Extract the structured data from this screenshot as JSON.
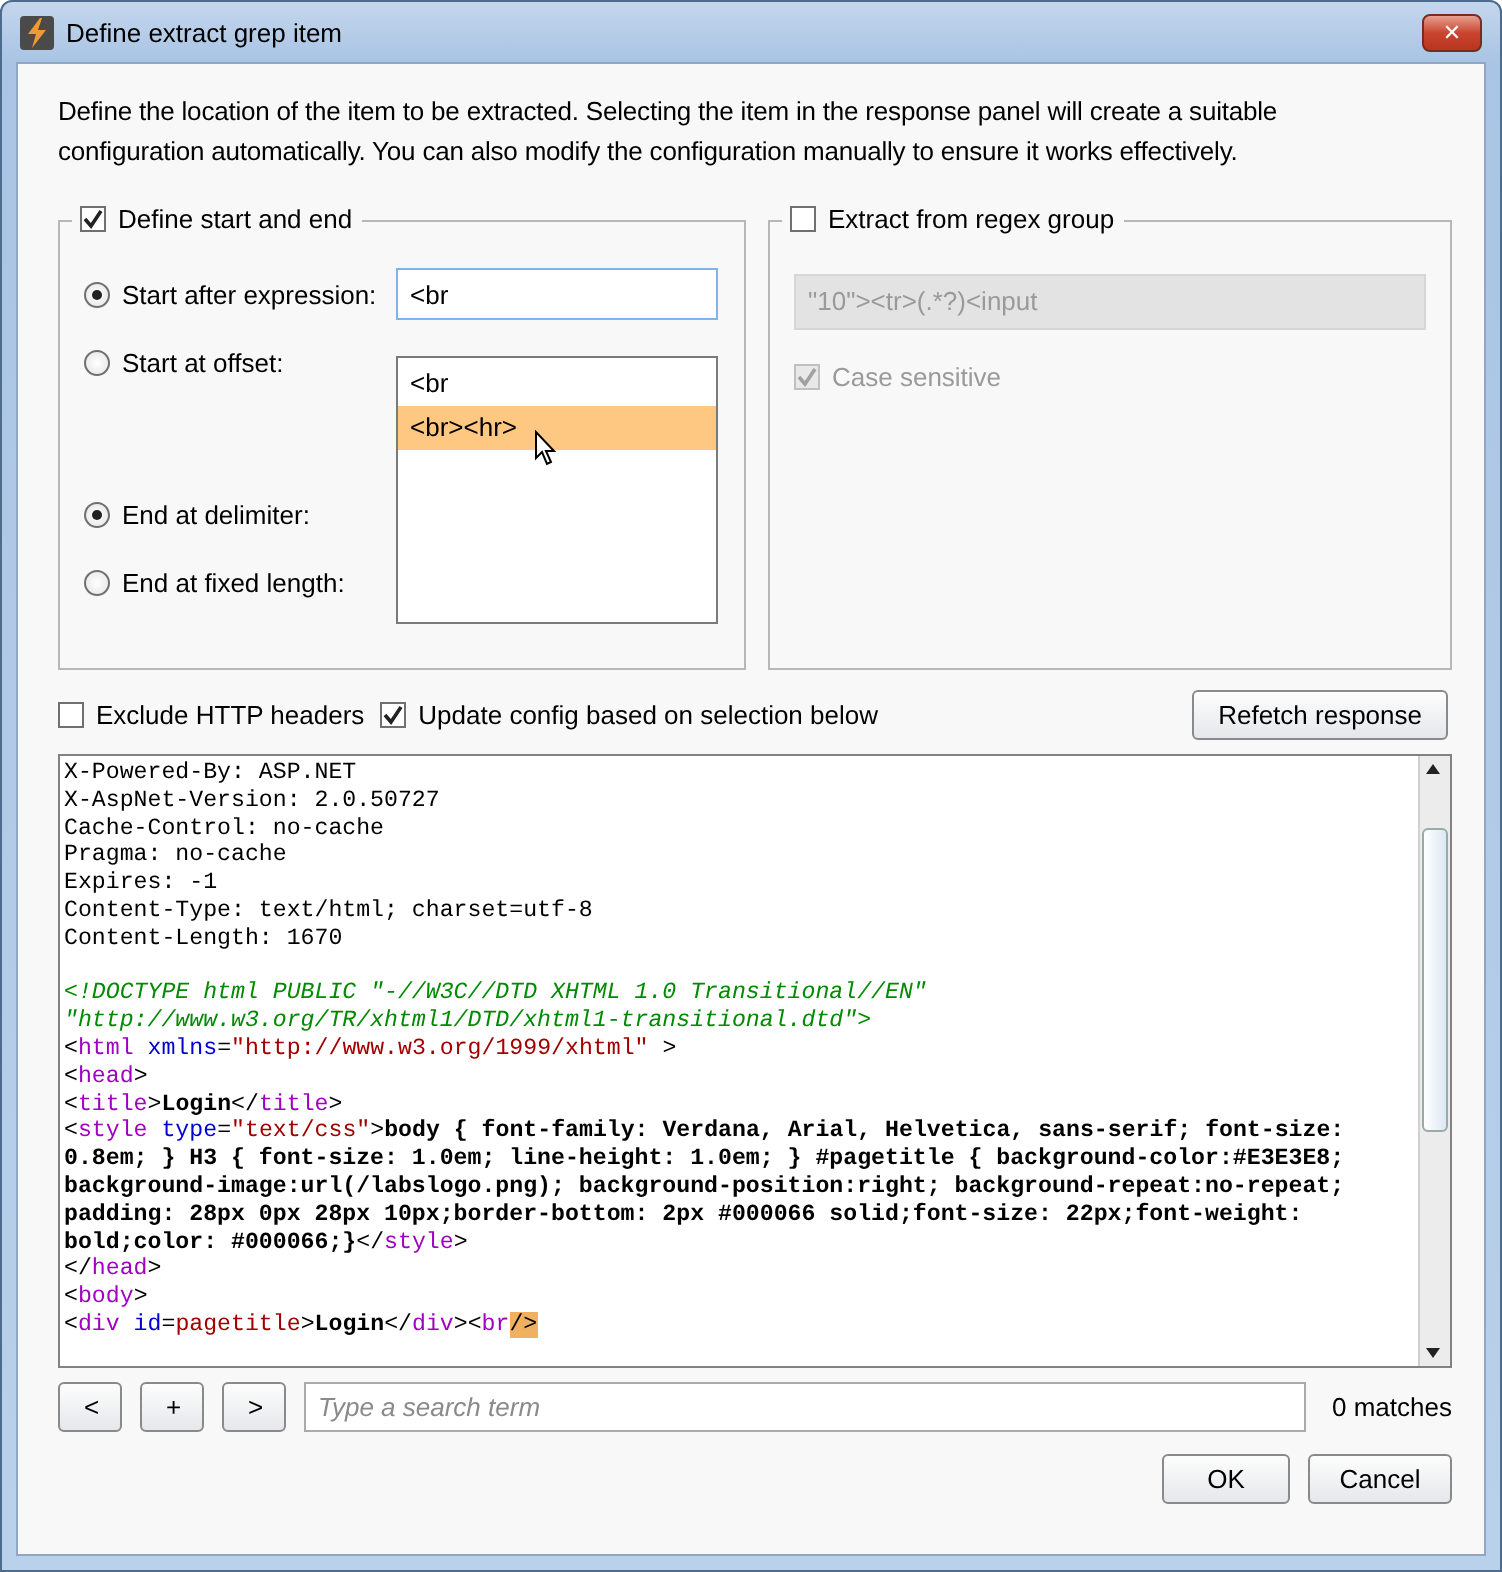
{
  "window": {
    "title": "Define extract grep item",
    "close": "✕"
  },
  "description": "Define the location of the item to be extracted. Selecting the item in the response panel will create a suitable configuration automatically. You can also modify the configuration manually to ensure it works effectively.",
  "start_end": {
    "label": "Define start and end",
    "checked": true,
    "start_options": [
      {
        "label": "Start after expression:",
        "selected": true
      },
      {
        "label": "Start at offset:",
        "selected": false
      }
    ],
    "end_options": [
      {
        "label": "End at delimiter:",
        "selected": true
      },
      {
        "label": "End at fixed length:",
        "selected": false
      }
    ],
    "expression_field": {
      "value": "<br"
    },
    "suggestions": [
      {
        "label": "<br",
        "selected": false
      },
      {
        "label": "<br><hr>",
        "selected": true
      }
    ]
  },
  "regex_group": {
    "label": "Extract from regex group",
    "checked": false,
    "field": {
      "value": "\"10\"><tr>(.*?)<input",
      "disabled": true
    },
    "case_sensitive": {
      "label": "Case sensitive",
      "checked": true,
      "disabled": true
    }
  },
  "options": [
    {
      "label": "Exclude HTTP headers",
      "checked": false
    },
    {
      "label": "Update config based on selection below",
      "checked": true
    }
  ],
  "refetch_button": "Refetch response",
  "response_lines": [
    {
      "segments": [
        {
          "kind": "text",
          "text": "X-Powered-By: ASP.NET"
        }
      ]
    },
    {
      "segments": [
        {
          "kind": "text",
          "text": "X-AspNet-Version: 2.0.50727"
        }
      ]
    },
    {
      "segments": [
        {
          "kind": "text",
          "text": "Cache-Control: no-cache"
        }
      ]
    },
    {
      "segments": [
        {
          "kind": "text",
          "text": "Pragma: no-cache"
        }
      ]
    },
    {
      "segments": [
        {
          "kind": "text",
          "text": "Expires: -1"
        }
      ]
    },
    {
      "segments": [
        {
          "kind": "text",
          "text": "Content-Type: text/html; charset=utf-8"
        }
      ]
    },
    {
      "segments": [
        {
          "kind": "text",
          "text": "Content-Length: 1670"
        }
      ]
    },
    {
      "gap_before": true,
      "segments": [
        {
          "kind": "comment",
          "text": "<!DOCTYPE html PUBLIC \"-//W3C//DTD XHTML 1.0 Transitional//EN\""
        }
      ]
    },
    {
      "segments": [
        {
          "kind": "comment",
          "text": "\"http://www.w3.org/TR/xhtml1/DTD/xhtml1-transitional.dtd\">"
        }
      ]
    },
    {
      "segments": [
        {
          "kind": "text",
          "text": "<"
        },
        {
          "kind": "tag",
          "text": "html"
        },
        {
          "kind": "attr",
          "text": " xmlns"
        },
        {
          "kind": "text",
          "text": "="
        },
        {
          "kind": "value",
          "text": "\"http://www.w3.org/1999/xhtml\""
        },
        {
          "kind": "text",
          "text": " >"
        }
      ]
    },
    {
      "segments": [
        {
          "kind": "text",
          "text": "<"
        },
        {
          "kind": "tag",
          "text": "head"
        },
        {
          "kind": "text",
          "text": ">"
        }
      ]
    },
    {
      "segments": [
        {
          "kind": "text",
          "text": "<"
        },
        {
          "kind": "tag",
          "text": "title"
        },
        {
          "kind": "text",
          "text": ">"
        },
        {
          "kind": "bold",
          "text": "Login"
        },
        {
          "kind": "text",
          "text": "</"
        },
        {
          "kind": "tag",
          "text": "title"
        },
        {
          "kind": "text",
          "text": ">"
        }
      ]
    },
    {
      "segments": [
        {
          "kind": "text",
          "text": "<"
        },
        {
          "kind": "tag",
          "text": "style"
        },
        {
          "kind": "attr",
          "text": " type"
        },
        {
          "kind": "text",
          "text": "="
        },
        {
          "kind": "value",
          "text": "\"text/css\""
        },
        {
          "kind": "text",
          "text": ">"
        },
        {
          "kind": "bold",
          "text": "body { font-family: Verdana, Arial, Helvetica, sans-serif; font-size:"
        }
      ]
    },
    {
      "segments": [
        {
          "kind": "bold",
          "text": "0.8em; } H3 { font-size: 1.0em; line-height: 1.0em; } #pagetitle { background-color:#E3E3E8;"
        }
      ]
    },
    {
      "segments": [
        {
          "kind": "bold",
          "text": "background-image:url(/labslogo.png); background-position:right; background-repeat:no-repeat;"
        }
      ]
    },
    {
      "segments": [
        {
          "kind": "bold",
          "text": "padding: 28px 0px 28px 10px;border-bottom: 2px #000066 solid;font-size: 22px;font-weight:"
        }
      ]
    },
    {
      "segments": [
        {
          "kind": "bold",
          "text": "bold;color: #000066;}"
        },
        {
          "kind": "text",
          "text": "</"
        },
        {
          "kind": "tag",
          "text": "style"
        },
        {
          "kind": "text",
          "text": ">"
        }
      ]
    },
    {
      "segments": [
        {
          "kind": "text",
          "text": "</"
        },
        {
          "kind": "tag",
          "text": "head"
        },
        {
          "kind": "text",
          "text": ">"
        }
      ]
    },
    {
      "segments": [
        {
          "kind": "text",
          "text": "<"
        },
        {
          "kind": "tag",
          "text": "body"
        },
        {
          "kind": "text",
          "text": ">"
        }
      ]
    },
    {
      "segments": [
        {
          "kind": "text",
          "text": "<"
        },
        {
          "kind": "tag",
          "text": "div"
        },
        {
          "kind": "attr",
          "text": " id"
        },
        {
          "kind": "text",
          "text": "="
        },
        {
          "kind": "value",
          "text": "pagetitle"
        },
        {
          "kind": "text",
          "text": ">"
        },
        {
          "kind": "bold",
          "text": "Login"
        },
        {
          "kind": "text",
          "text": "</"
        },
        {
          "kind": "tag",
          "text": "div"
        },
        {
          "kind": "text",
          "text": "><"
        },
        {
          "kind": "tag",
          "text": "br"
        },
        {
          "kind": "highlight",
          "text": "/>"
        }
      ]
    }
  ],
  "search": {
    "nav_buttons": [
      "<",
      "+",
      ">"
    ],
    "placeholder": "Type a search term",
    "matches": "0 matches"
  },
  "buttons": [
    "OK",
    "Cancel"
  ]
}
